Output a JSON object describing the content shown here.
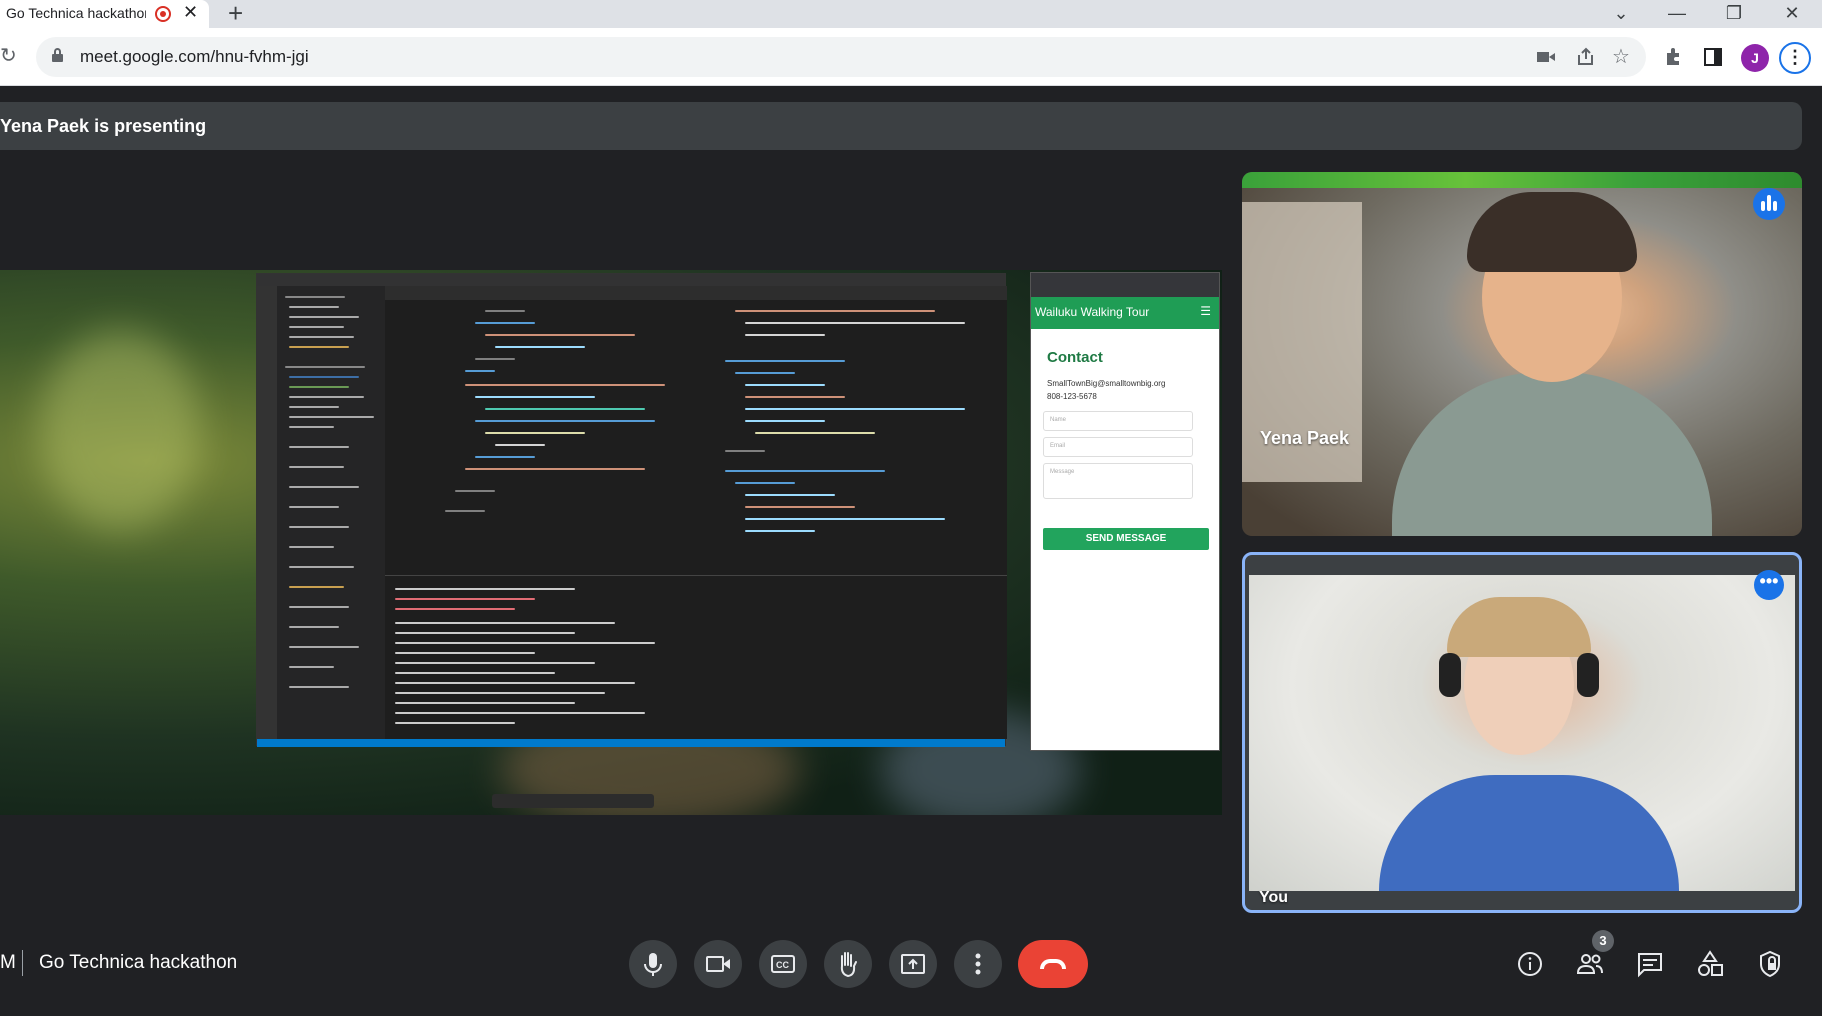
{
  "browser": {
    "tab_title": "Go Technica hackathon",
    "tab_close": "✕",
    "new_tab": "+",
    "url": "meet.google.com/hnu-fvhm-jgi",
    "profile_initial": "J",
    "window_controls": [
      "⌄",
      "—",
      "❐",
      "✕"
    ]
  },
  "meet": {
    "presenting_banner": "Yena Paek is presenting",
    "meeting_code_short": "M",
    "meeting_title": "Go Technica hackathon",
    "participants": [
      {
        "name": "Yena Paek",
        "speaking": true
      },
      {
        "name": "You",
        "speaking": false
      }
    ],
    "participant_count": "3",
    "more_options_label": "•••"
  },
  "shared_screen": {
    "site_title": "Wailuku Walking Tour",
    "menu_icon": "☰",
    "contact_heading": "Contact",
    "email": "SmallTownBig@smalltownbig.org",
    "phone": "808-123-5678",
    "name_placeholder": "Name",
    "email_placeholder": "Email",
    "message_placeholder": "Message",
    "send_button": "SEND MESSAGE"
  },
  "controls": {
    "icons": [
      "microphone-icon",
      "camera-icon",
      "captions-icon",
      "raise-hand-icon",
      "present-icon",
      "more-icon",
      "hang-up-icon"
    ],
    "right_icons": [
      "info-icon",
      "people-icon",
      "chat-icon",
      "activities-icon",
      "host-controls-icon"
    ]
  }
}
